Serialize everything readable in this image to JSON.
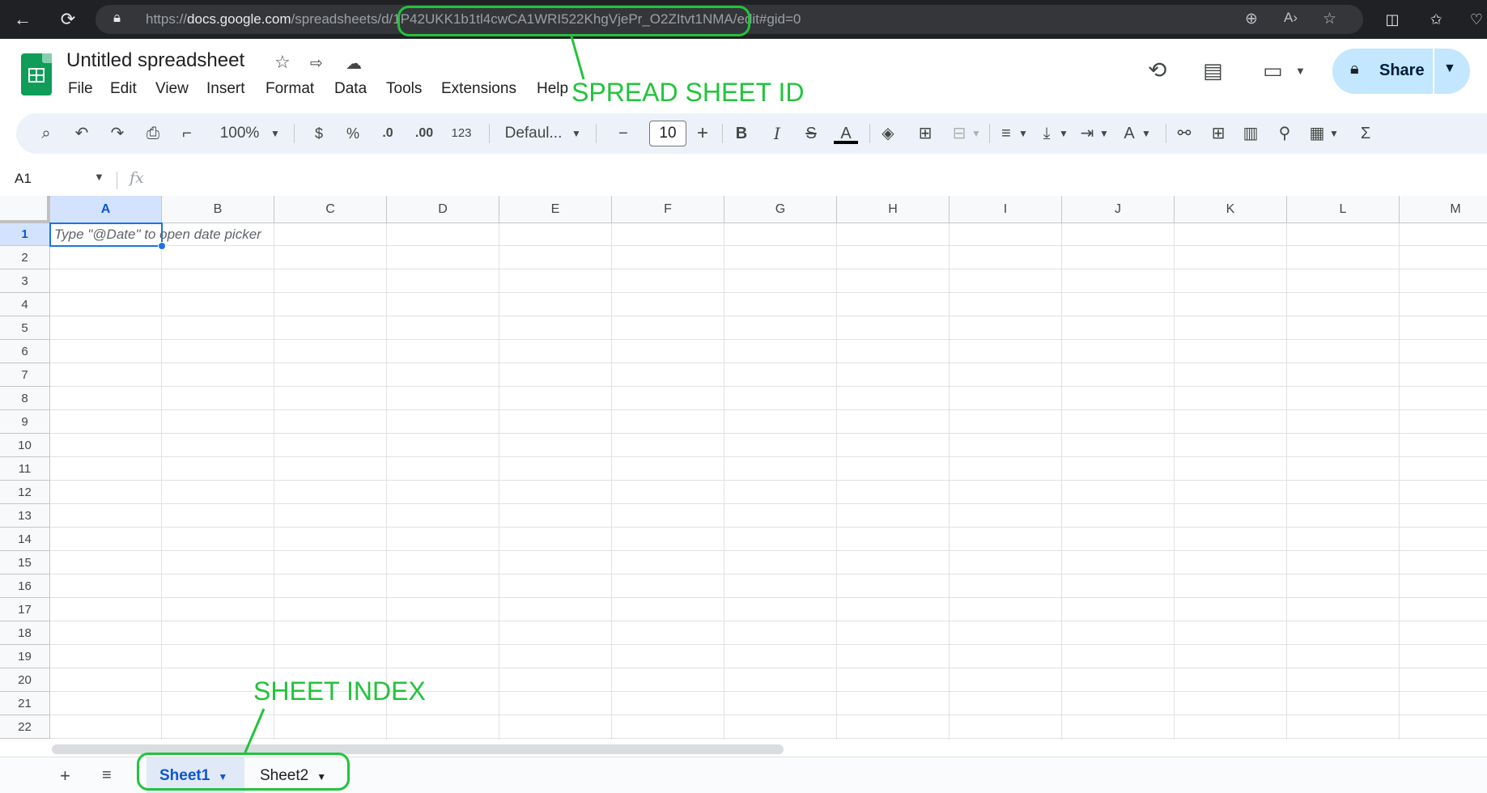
{
  "browser": {
    "url_prefix": "https://",
    "url_host": "docs.google.com",
    "url_path1": "/spreadsheets/d/",
    "url_id": "1P42UKK1b1tl4cwCA1WRI522KhgVjePr_O2ZItvt1NMA",
    "url_suffix": "/edit#gid=0",
    "icons": [
      "back-icon",
      "reload-icon",
      "lock-icon",
      "zoom-icon",
      "read-aloud-icon",
      "favorite-icon",
      "split-screen-icon",
      "favorites-icon",
      "extensions-icon"
    ]
  },
  "header": {
    "title": "Untitled spreadsheet",
    "menus": [
      "File",
      "Edit",
      "View",
      "Insert",
      "Format",
      "Data",
      "Tools",
      "Extensions",
      "Help"
    ],
    "share_label": "Share"
  },
  "toolbar": {
    "zoom": "100%",
    "currency": "$",
    "percent": "%",
    "decrease_decimal": ".0",
    "increase_decimal": ".00",
    "number_format": "123",
    "font": "Defaul...",
    "font_size": "10",
    "bold": "B",
    "italic": "I"
  },
  "formula_bar": {
    "name_box": "A1",
    "fx": "fx"
  },
  "grid": {
    "columns": [
      "A",
      "B",
      "C",
      "D",
      "E",
      "F",
      "G",
      "H",
      "I",
      "J",
      "K",
      "L",
      "M"
    ],
    "rows": [
      "1",
      "2",
      "3",
      "4",
      "5",
      "6",
      "7",
      "8",
      "9",
      "10",
      "11",
      "12",
      "13",
      "14",
      "15",
      "16",
      "17",
      "18",
      "19",
      "20",
      "21",
      "22"
    ],
    "selected_cell": "A1",
    "cell_hint": "Type \"@Date\" to open date picker"
  },
  "sheets": {
    "tabs": [
      "Sheet1",
      "Sheet2"
    ],
    "active": "Sheet1"
  },
  "annotations": {
    "spreadsheet_id_label": "SPREAD SHEET ID",
    "sheet_index_label": "SHEET INDEX",
    "color": "#22c33c"
  }
}
